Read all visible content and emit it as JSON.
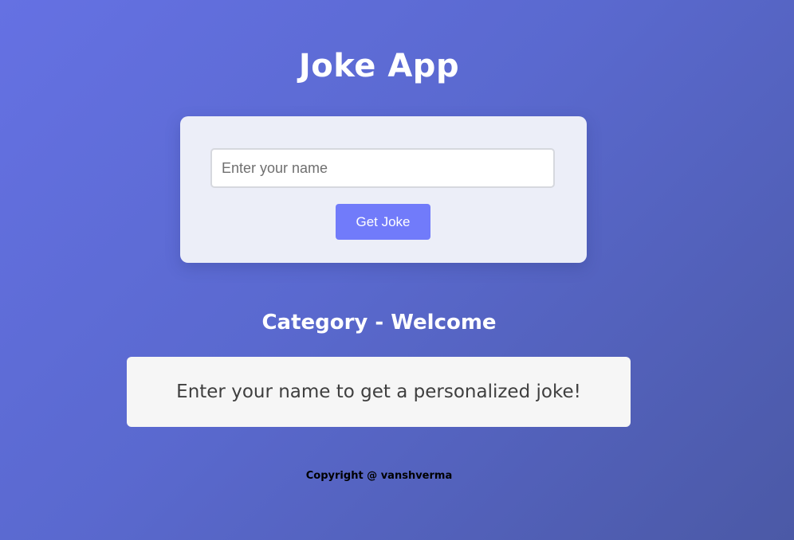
{
  "header": {
    "title": "Joke App"
  },
  "form": {
    "name_input": {
      "value": "",
      "placeholder": "Enter your name"
    },
    "submit_label": "Get Joke"
  },
  "result": {
    "category_label": "Category - Welcome",
    "joke_text": "Enter your name to get a personalized joke!"
  },
  "footer": {
    "copyright": "Copyright @ vanshverma"
  },
  "colors": {
    "background_start": "#6571e3",
    "background_end": "#4b59a6",
    "card": "#eceef8",
    "button": "#717bfa",
    "joke_box": "#f6f6f6"
  }
}
